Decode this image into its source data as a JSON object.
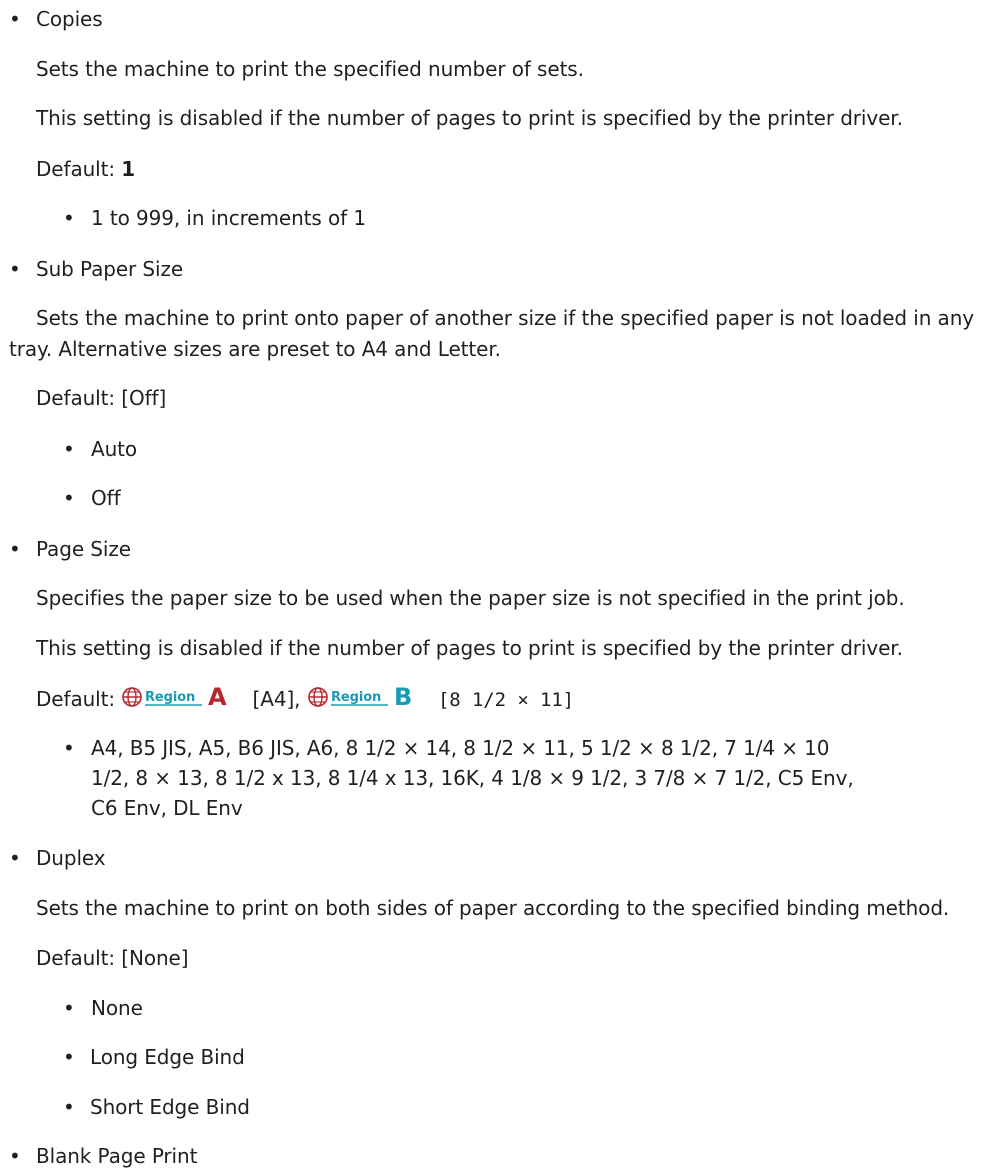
{
  "copies": {
    "title": "Copies",
    "desc1": "Sets the machine to print the specified number of sets.",
    "desc2": "This setting is disabled if the number of pages to print is specified by the printer driver.",
    "default_label": "Default: ",
    "default_value": "1",
    "options": [
      "1 to 999, in increments of 1"
    ]
  },
  "sub_paper": {
    "title": "Sub Paper Size",
    "desc_line1": "Sets the machine to print onto paper of another size if the specified paper is not loaded in any",
    "desc_line2": "tray. Alternative sizes are preset to A4 and Letter.",
    "default_text": "Default: [Off]",
    "options": [
      "Auto",
      "Off"
    ]
  },
  "page_size": {
    "title": "Page Size",
    "desc1": "Specifies the paper size to be used when the paper size is not specified in the print job.",
    "desc2": "This setting is disabled if the number of pages to print is specified by the printer driver.",
    "default_label": "Default: ",
    "region_word": "Region",
    "region_a_letter": "A",
    "region_a_value": "[A4],",
    "region_b_letter": "B",
    "region_b_value": "[8 1/2 × 11]",
    "region_a_color": "#b5282e",
    "region_b_color": "#1a9bb5",
    "options_line1": "A4, B5 JIS, A5, B6 JIS, A6, 8 1/2 × 14, 8 1/2 × 11, 5 1/2 × 8 1/2, 7 1/4 × 10",
    "options_line2": "1/2, 8 × 13, 8 1/2 x 13, 8 1/4 x 13, 16K, 4 1/8 × 9 1/2, 3 7/8 × 7 1/2, C5 Env,",
    "options_line3": "C6 Env, DL Env"
  },
  "duplex": {
    "title": "Duplex",
    "desc": "Sets the machine to print on both sides of paper according to the specified binding method.",
    "default_text": "Default: [None]",
    "options": [
      "None",
      "Long Edge Bind",
      "Short Edge Bind"
    ]
  },
  "blank_page": {
    "title": "Blank Page Print"
  },
  "bullet_char": "•"
}
